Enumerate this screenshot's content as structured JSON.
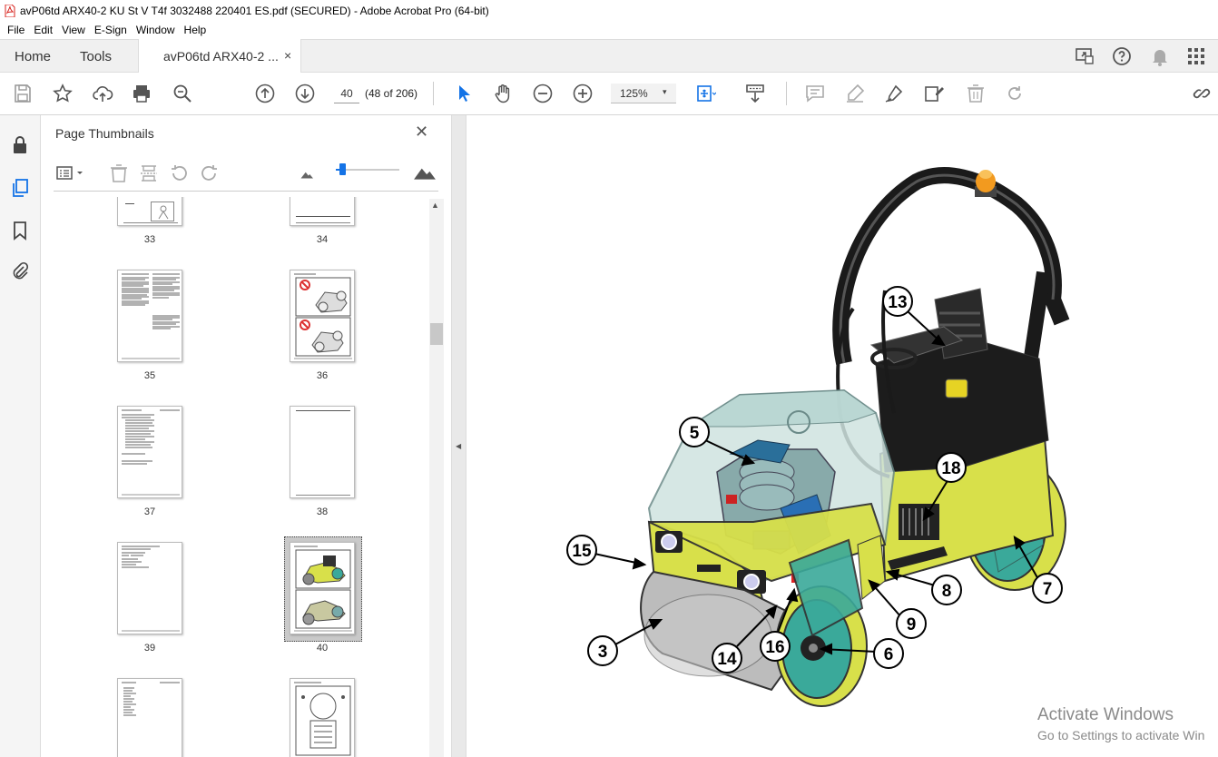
{
  "window": {
    "title": "avP06td ARX40-2 KU St V T4f 3032488 220401 ES.pdf (SECURED) - Adobe Acrobat Pro (64-bit)",
    "icon": "pdf-file-icon"
  },
  "menu": [
    "File",
    "Edit",
    "View",
    "E-Sign",
    "Window",
    "Help"
  ],
  "tabs": {
    "home": "Home",
    "tools": "Tools",
    "document": "avP06td ARX40-2 ...",
    "close": "×"
  },
  "toolbar": {
    "page_input": "40",
    "page_count": "(48 of 206)",
    "zoom": "125%",
    "zoom_caret": "▾"
  },
  "panel": {
    "title": "Page Thumbnails",
    "close": "✕",
    "thumbnails": [
      {
        "label": "33"
      },
      {
        "label": "34"
      },
      {
        "label": "35"
      },
      {
        "label": "36"
      },
      {
        "label": "37"
      },
      {
        "label": "38"
      },
      {
        "label": "39"
      },
      {
        "label": "40",
        "selected": true
      },
      {
        "label": ""
      },
      {
        "label": ""
      }
    ],
    "thumbnail_slider_level": 0.1
  },
  "figure": {
    "callouts": [
      "13",
      "5",
      "18",
      "15",
      "8",
      "7",
      "9",
      "3",
      "16",
      "6",
      "14"
    ]
  },
  "watermark": {
    "line1": "Activate Windows",
    "line2": "Go to Settings to activate Win"
  },
  "colors": {
    "accent": "#1473e6",
    "machine_yellow": "#d8e04a",
    "drum_teal": "#3aa99a"
  }
}
